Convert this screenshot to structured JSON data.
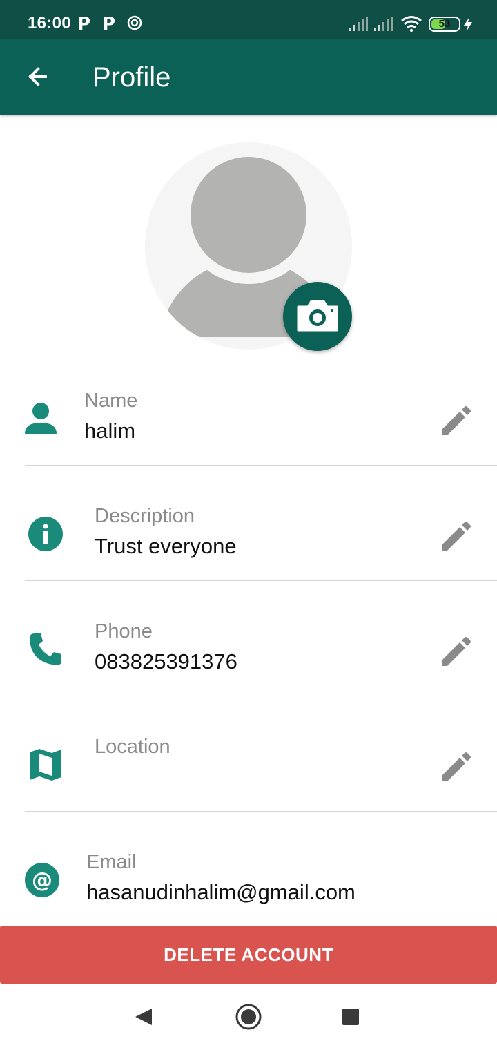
{
  "status_bar": {
    "time": "16:00",
    "notification_icons": [
      "P",
      "P"
    ],
    "battery_percent": 53,
    "battery_label": "53",
    "charging": true
  },
  "app_bar": {
    "title": "Profile",
    "back_icon": "arrow-back-icon"
  },
  "colors": {
    "primary_dark": "#0f4f46",
    "primary": "#0b6155",
    "accent_icon": "#1a8a7a",
    "danger": "#d9534f",
    "label_gray": "#8a8a8a"
  },
  "profile": {
    "avatar_icon": "default-avatar-icon",
    "camera_icon": "camera-icon",
    "fields": [
      {
        "icon": "person-icon",
        "label": "Name",
        "value": "halim",
        "editable": true
      },
      {
        "icon": "info-icon",
        "label": "Description",
        "value": "Trust everyone",
        "editable": true
      },
      {
        "icon": "phone-icon",
        "label": "Phone",
        "value": "083825391376",
        "editable": true
      },
      {
        "icon": "map-icon",
        "label": "Location",
        "value": "",
        "editable": true
      },
      {
        "icon": "at-icon",
        "label": "Email",
        "value": "hasanudinhalim@gmail.com",
        "editable": false
      }
    ]
  },
  "actions": {
    "delete_label": "DELETE ACCOUNT"
  },
  "nav_bar": {
    "buttons": [
      "back-nav-icon",
      "home-nav-icon",
      "recents-nav-icon"
    ]
  }
}
